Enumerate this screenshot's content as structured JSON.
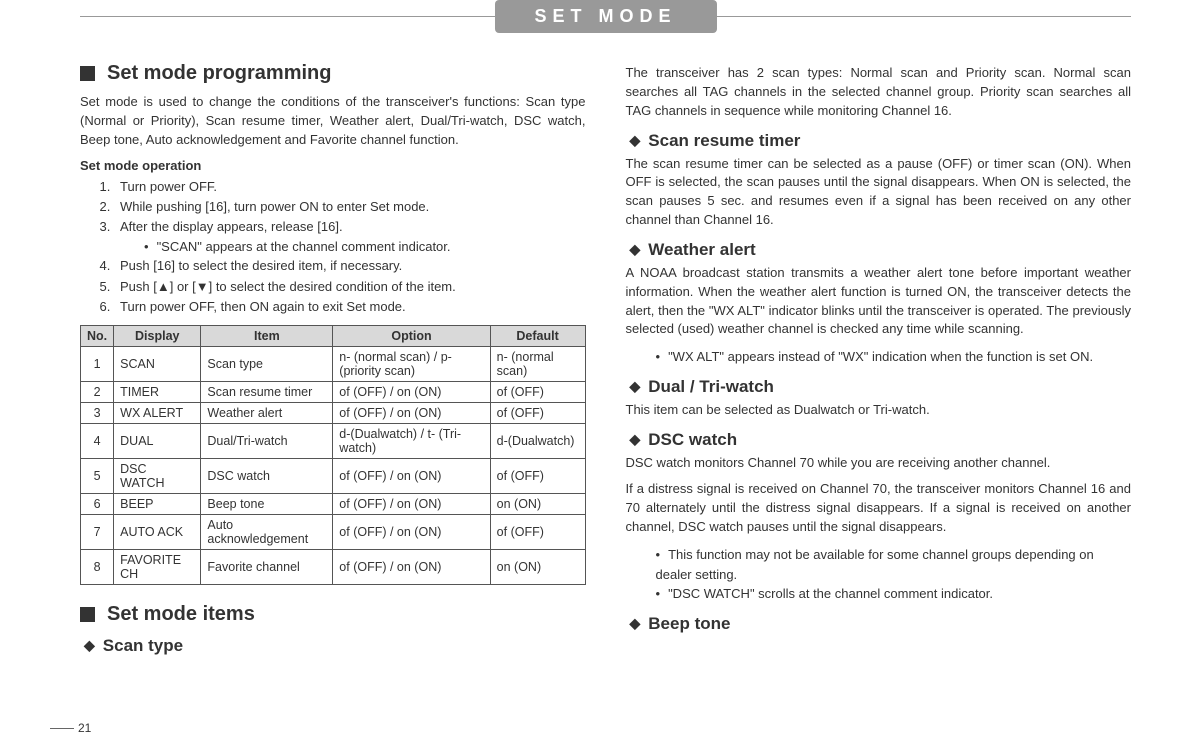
{
  "header": {
    "title": "SET MODE"
  },
  "page_number": "21",
  "left": {
    "h_programming": "Set mode programming",
    "intro": "Set mode is used to change the conditions of the transceiver's functions: Scan type (Normal or Priority), Scan resume timer, Weather alert, Dual/Tri-watch, DSC watch, Beep tone, Auto acknowledgement and Favorite channel function.",
    "op_title": "Set mode operation",
    "steps": [
      "Turn power OFF.",
      "While pushing [16], turn power ON to enter Set mode.",
      "After the display appears, release [16].",
      "Push [16] to select the desired item, if necessary.",
      "Push [▲] or [▼] to select the desired condition of the item.",
      "Turn power OFF, then ON again to exit Set mode."
    ],
    "step3_sub": "\"SCAN\" appears at the channel comment indicator.",
    "table": {
      "headers": [
        "No.",
        "Display",
        "Item",
        "Option",
        "Default"
      ],
      "rows": [
        {
          "no": "1",
          "display": "SCAN",
          "item": "Scan type",
          "option": "n- (normal scan) / p- (priority scan)",
          "def": "n- (normal scan)"
        },
        {
          "no": "2",
          "display": "TIMER",
          "item": "Scan resume timer",
          "option": "of (OFF) / on (ON)",
          "def": "of (OFF)"
        },
        {
          "no": "3",
          "display": "WX ALERT",
          "item": "Weather alert",
          "option": "of (OFF) / on (ON)",
          "def": "of (OFF)"
        },
        {
          "no": "4",
          "display": "DUAL",
          "item": "Dual/Tri-watch",
          "option": "d-(Dualwatch) / t- (Tri-watch)",
          "def": "d-(Dualwatch)"
        },
        {
          "no": "5",
          "display": "DSC WATCH",
          "item": "DSC watch",
          "option": "of (OFF) / on (ON)",
          "def": "of (OFF)"
        },
        {
          "no": "6",
          "display": "BEEP",
          "item": "Beep tone",
          "option": "of (OFF) / on (ON)",
          "def": "on (ON)"
        },
        {
          "no": "7",
          "display": "AUTO ACK",
          "item": "Auto acknowledgement",
          "option": "of (OFF) / on (ON)",
          "def": "of (OFF)"
        },
        {
          "no": "8",
          "display": "FAVORITE CH",
          "item": "Favorite channel",
          "option": "of (OFF) / on (ON)",
          "def": "on (ON)"
        }
      ]
    },
    "h_items": "Set mode items",
    "sub_scantype": "Scan type"
  },
  "right": {
    "scan_type_body": "The transceiver has 2 scan types: Normal scan and Priority scan. Normal scan searches all TAG channels in the selected channel group. Priority scan searches all TAG channels in sequence while monitoring Channel 16.",
    "sub_resume": "Scan resume timer",
    "resume_body": "The scan resume timer can be selected as a pause (OFF) or timer scan (ON). When OFF is selected, the scan pauses until the signal disappears. When ON is selected, the scan pauses 5 sec. and resumes even if a signal has been received on any other channel than Channel 16.",
    "sub_wx": "Weather alert",
    "wx_body": "A NOAA broadcast station transmits a weather alert tone before important weather information. When the weather alert function is turned ON, the transceiver detects the alert, then the \"WX ALT\" indicator blinks until the transceiver is operated. The previously selected (used) weather channel is checked any time while scanning.",
    "wx_bullet": "\"WX ALT\" appears instead of \"WX\" indication when the function is set ON.",
    "sub_dual": "Dual / Tri-watch",
    "dual_body": "This item can be selected as Dualwatch or Tri-watch.",
    "sub_dsc": "DSC watch",
    "dsc_body1": "DSC watch monitors Channel 70 while you are receiving another channel.",
    "dsc_body2": "If a distress signal is received on Channel 70, the transceiver monitors Channel 16 and 70 alternately until the distress signal disappears. If a signal is received on another channel, DSC watch pauses until the signal disappears.",
    "dsc_bullets": [
      "This function may not be available for some channel groups depending on dealer setting.",
      "\"DSC WATCH\" scrolls at the channel comment indicator."
    ],
    "sub_beep": "Beep tone"
  }
}
